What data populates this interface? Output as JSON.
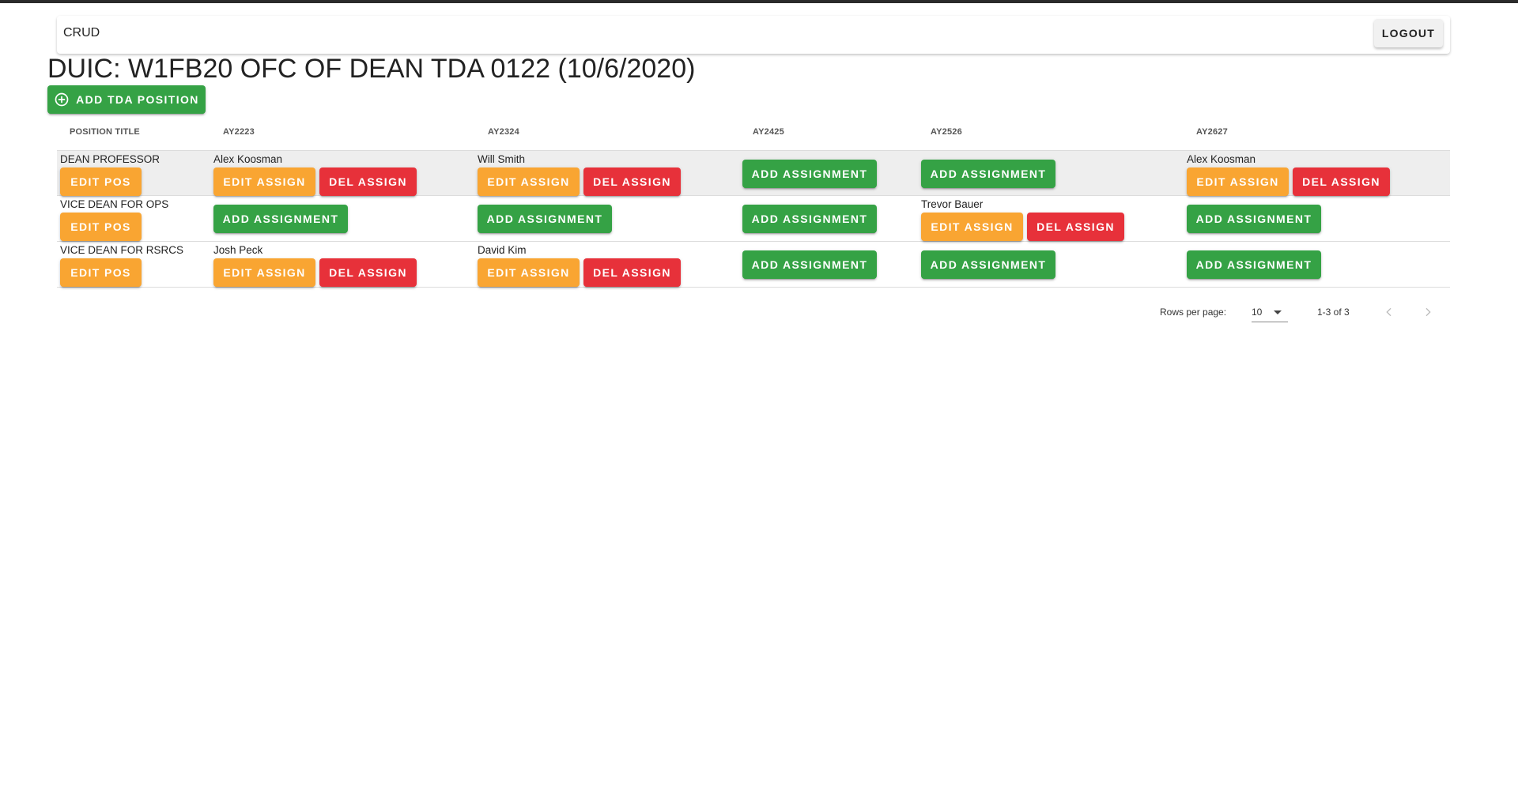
{
  "app": {
    "title": "CRUD",
    "logout_label": "LOGOUT"
  },
  "page": {
    "title": "DUIC: W1FB20 OFC OF DEAN TDA 0122 (10/6/2020)",
    "add_position_label": "ADD TDA POSITION"
  },
  "table": {
    "headers": [
      "POSITION TITLE",
      "AY2223",
      "AY2324",
      "AY2425",
      "AY2526",
      "AY2627"
    ],
    "edit_pos_label": "EDIT POS",
    "edit_assign_label": "EDIT ASSIGN",
    "del_assign_label": "DEL ASSIGN",
    "add_assignment_label": "ADD ASSIGNMENT",
    "rows": [
      {
        "title": "DEAN PROFESSOR",
        "cells": [
          "Alex Koosman",
          "Will Smith",
          null,
          null,
          "Alex Koosman"
        ]
      },
      {
        "title": "VICE DEAN FOR OPS",
        "cells": [
          null,
          null,
          null,
          "Trevor Bauer",
          null
        ]
      },
      {
        "title": "VICE DEAN FOR RSRCS",
        "cells": [
          "Josh Peck",
          "David Kim",
          null,
          null,
          null
        ]
      }
    ]
  },
  "pagination": {
    "rows_per_page_label": "Rows per page:",
    "rows_per_page_value": "10",
    "range": "1-3 of 3"
  },
  "colors": {
    "add": "#35a245",
    "edit": "#f9a532",
    "delete": "#e7313a",
    "highlight_row": "#eeeeee"
  },
  "icons": [
    "plus-circle-icon",
    "chevron-left-icon",
    "chevron-right-icon",
    "dropdown-arrow-icon"
  ]
}
